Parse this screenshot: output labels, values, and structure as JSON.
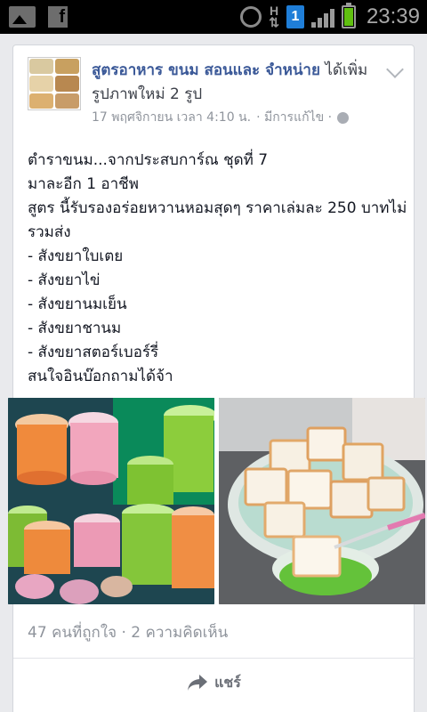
{
  "status_bar": {
    "time": "23:39",
    "network_h": "H",
    "sim_slot": "1",
    "icons": [
      "gallery-icon",
      "facebook-icon",
      "alarm-icon",
      "hspa-icon",
      "sim-icon",
      "signal-icon",
      "battery-icon"
    ]
  },
  "post": {
    "page_name": "สูตรอาหาร ขนม สอนและ จำหน่าย",
    "action_text": "ได้เพิ่มรูปภาพใหม่ 2 รูป",
    "timestamp": "17 พฤศจิกายน เวลา 4:10 น.",
    "edited": "· มีการแก้ไข ·",
    "body_lines": [
      "ตำราขนม...จากประสบการ์ณ ชุดที่ 7",
      "มาละอีก 1 อาชีพ",
      "สูตร นี้รับรองอร่อยหวานหอมสุดๆ ราคาเล่มละ 250 บาทไม่",
      "รวมส่ง",
      "- สังขยาใบเตย",
      "- สังขยาไข่",
      "- สังขยานมเย็น",
      "- สังขยาชานม",
      "- สังขยาสตอร์เบอร์รี่",
      "สนใจอินบ๊อกถามได้จ้า"
    ],
    "likes": "47 คนที่ถูกใจ",
    "comments": "· 2 ความคิดเห็น",
    "share_label": "แชร์"
  },
  "colors": {
    "brand_blue": "#3b5998",
    "meta_gray": "#8f949c",
    "background": "#e9eaed"
  }
}
